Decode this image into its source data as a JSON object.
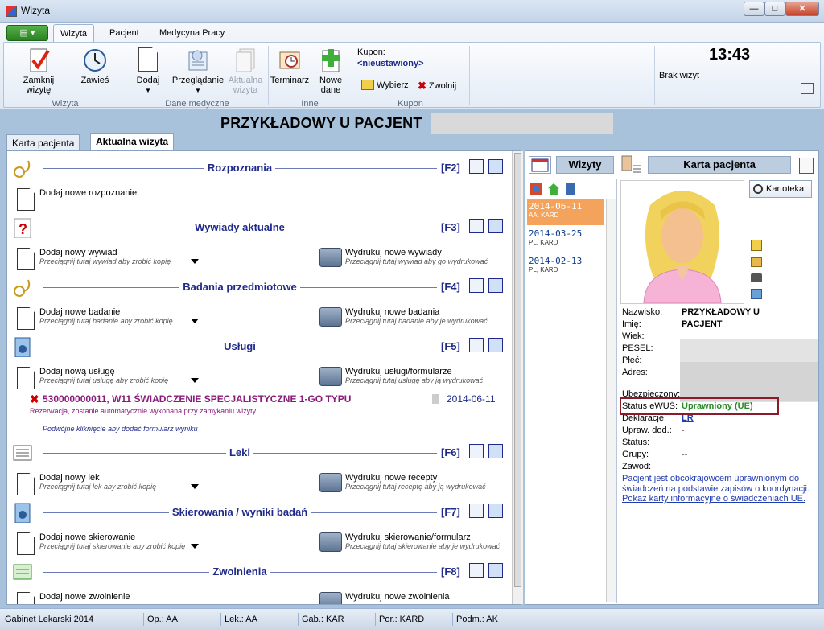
{
  "window": {
    "title": "Wizyta",
    "min": "—",
    "max": "□",
    "close": "✕"
  },
  "ribbon": {
    "app_menu": "▤ ▾",
    "tabs": [
      "Wizyta",
      "Pacjent",
      "Medycyna Pracy"
    ],
    "buttons": {
      "close_visit": "Zamknij wizytę",
      "suspend": "Zawieś",
      "add": "Dodaj",
      "browse": "Przeglądanie",
      "current_visit": "Aktualna wizyta",
      "scheduler": "Terminarz",
      "new_data": "Nowe dane",
      "select": "Wybierz",
      "release": "Zwolnij"
    },
    "groups": [
      "Wizyta",
      "Dane medyczne",
      "Inne",
      "Kupon"
    ],
    "coupon_label": "Kupon:",
    "coupon_value": "<nieustawiony>",
    "clock": "13:43",
    "no_visits": "Brak wizyt"
  },
  "patient": {
    "name": "PRZYKŁADOWY U PACJENT"
  },
  "tabs": [
    "Karta pacjenta",
    "Aktualna wizyta"
  ],
  "sections": {
    "diagnoses": {
      "title": "Rozpoznania",
      "key": "[F2]",
      "add": "Dodaj nowe rozpoznanie"
    },
    "interviews": {
      "title": "Wywiady aktualne",
      "key": "[F3]",
      "add": "Dodaj nowy wywiad",
      "add_sub": "Przeciągnij tutaj wywiad aby zrobić kopię",
      "print": "Wydrukuj nowe wywiady",
      "print_sub": "Przeciągnij tutaj wywiad aby go wydrukować"
    },
    "exams": {
      "title": "Badania przedmiotowe",
      "key": "[F4]",
      "add": "Dodaj nowe badanie",
      "add_sub": "Przeciągnij tutaj badanie aby zrobić kopię",
      "print": "Wydrukuj nowe badania",
      "print_sub": "Przeciągnij tutaj badanie aby je wydrukować"
    },
    "services": {
      "title": "Usługi",
      "key": "[F5]",
      "add": "Dodaj nową usługę",
      "add_sub": "Przeciągnij tutaj usługę aby zrobić kopię",
      "print": "Wydrukuj usługi/formularze",
      "print_sub": "Przeciągnij tutaj usługę aby ją wydrukować",
      "item_code": "530000000011, W11 ŚWIADCZENIE SPECJALISTYCZNE 1-GO TYPU",
      "item_date": "2014-06-11",
      "item_note": "Rezerwacja, zostanie automatycznie wykonana przy zamykaniu wizyty",
      "item_hint": "Podwójne kliknięcie aby dodać formularz wyniku"
    },
    "drugs": {
      "title": "Leki",
      "key": "[F6]",
      "add": "Dodaj nowy lek",
      "add_sub": "Przeciągnij tutaj lek aby zrobić kopię",
      "print": "Wydrukuj nowe recepty",
      "print_sub": "Przeciągnij tutaj receptę aby ją wydrukować"
    },
    "referrals": {
      "title": "Skierowania / wyniki badań",
      "key": "[F7]",
      "add": "Dodaj nowe skierowanie",
      "add_sub": "Przeciągnij tutaj skierowanie aby zrobić kopię",
      "print": "Wydrukuj skierowanie/formularz",
      "print_sub": "Przeciągnij tutaj skierowanie aby je wydrukować"
    },
    "leaves": {
      "title": "Zwolnienia",
      "key": "[F8]",
      "add": "Dodaj nowe zwolnienie",
      "print": "Wydrukuj nowe zwolnienia"
    }
  },
  "right": {
    "visits_label": "Wizyty",
    "card_label": "Karta pacjenta",
    "file_button": "Kartoteka",
    "visits": [
      {
        "date": "2014-06-11",
        "sub": "AA, KARD"
      },
      {
        "date": "2014-03-25",
        "sub": "PL, KARD"
      },
      {
        "date": "2014-02-13",
        "sub": "PL, KARD"
      }
    ],
    "fields": {
      "surname_label": "Nazwisko:",
      "surname": "PRZYKŁADOWY U",
      "name_label": "Imię:",
      "name": "PACJENT",
      "age_label": "Wiek:",
      "pesel_label": "PESEL:",
      "sex_label": "Płeć:",
      "address_label": "Adres:",
      "insured_label": "Ubezpieczony:",
      "ewus_label": "Status eWUŚ:",
      "ewus_value": "Uprawniony (UE)",
      "decl_label": "Deklaracje:",
      "decl_value": "LR",
      "perm_label": "Upraw. dod.:",
      "perm_value": "-",
      "status_label": "Status:",
      "groups_label": "Grupy:",
      "groups_value": "--",
      "job_label": "Zawód:"
    },
    "note": "Pacjent jest obcokrajowcem uprawnionym do świadczeń na podstawie zapisów o koordynacji.",
    "link": "Pokaż karty informacyjne o świadczeniach UE."
  },
  "statusbar": [
    "Gabinet Lekarski 2014",
    "Op.: AA",
    "Lek.: AA",
    "Gab.: KAR",
    "Por.: KARD",
    "Podm.: AK"
  ]
}
